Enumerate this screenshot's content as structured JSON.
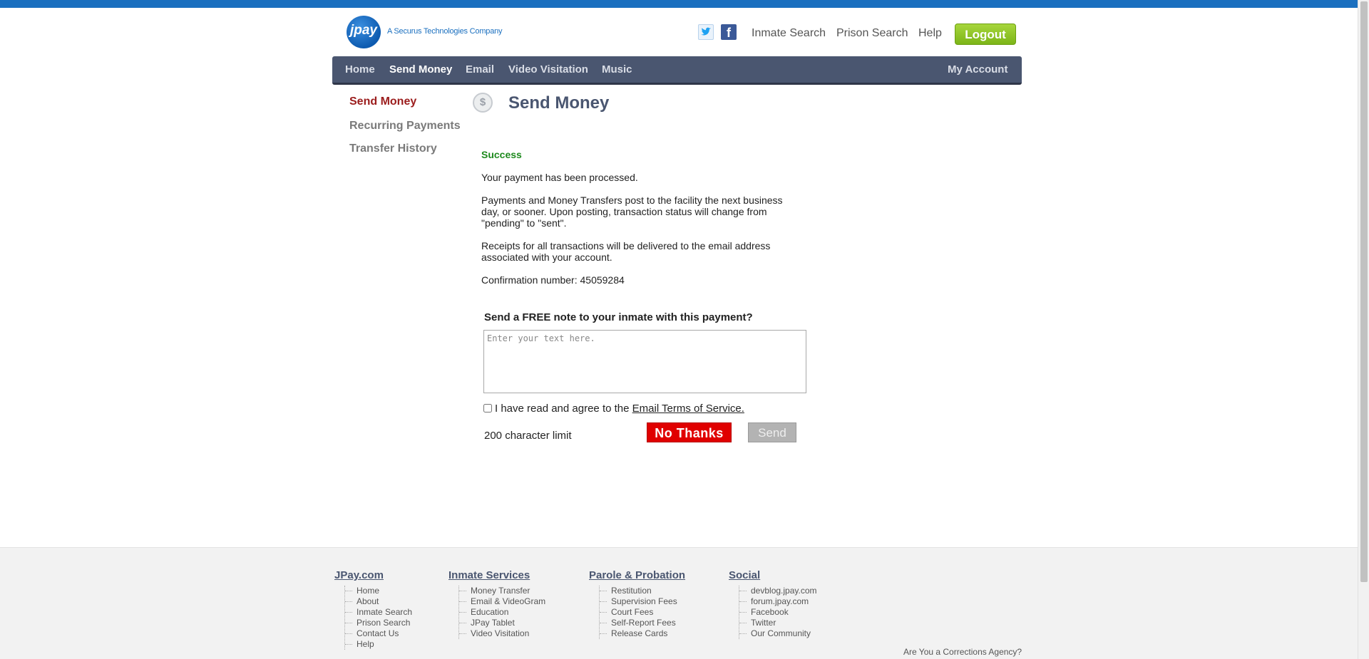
{
  "header": {
    "logo_text": "jpay",
    "tagline": "A Securus Technologies Company",
    "links": [
      "Inmate Search",
      "Prison Search",
      "Help"
    ],
    "logout_label": "Logout"
  },
  "nav": {
    "items": [
      "Home",
      "Send Money",
      "Email",
      "Video Visitation",
      "Music"
    ],
    "active": "Send Money",
    "account_label": "My Account"
  },
  "sidebar": {
    "items": [
      {
        "label": "Send Money",
        "active": true
      },
      {
        "label": "Recurring Payments",
        "active": false
      },
      {
        "label": "Transfer History",
        "active": false
      }
    ]
  },
  "main": {
    "page_icon": "money-icon",
    "title": "Send Money",
    "status": "Success",
    "messages": [
      "Your payment has been processed.",
      "Payments and Money Transfers post to the facility the next business day, or sooner. Upon posting, transaction status will change from \"pending\" to \"sent\".",
      "Receipts for all transactions will be delivered to the email address associated with your account.",
      "Confirmation number: 45059284"
    ],
    "note_prompt": "Send a FREE note to your inmate with this payment?",
    "note_placeholder": "Enter your text here.",
    "note_value": "",
    "agree_text": "I have read and agree to the",
    "agree_link": "Email Terms of Service.",
    "agree_checked": false,
    "char_limit": "200 character limit",
    "no_thanks_label": "No Thanks",
    "send_label": "Send"
  },
  "footer": {
    "columns": [
      {
        "title": "JPay.com",
        "links": [
          "Home",
          "About",
          "Inmate Search",
          "Prison Search",
          "Contact Us",
          "Help"
        ]
      },
      {
        "title": "Inmate Services",
        "links": [
          "Money Transfer",
          "Email & VideoGram",
          "Education",
          "JPay Tablet",
          "Video Visitation"
        ]
      },
      {
        "title": "Parole & Probation",
        "links": [
          "Restitution",
          "Supervision Fees",
          "Court Fees",
          "Self-Report Fees",
          "Release Cards"
        ]
      },
      {
        "title": "Social",
        "links": [
          "devblog.jpay.com",
          "forum.jpay.com",
          "Facebook",
          "Twitter",
          "Our Community"
        ]
      }
    ],
    "corrections_link": "Are You a Corrections Agency?"
  },
  "colors": {
    "brand_blue": "#1a6fbf",
    "nav_bg": "#4a5670",
    "success_green": "#1e8a1e",
    "active_red": "#9b1c1c",
    "no_thanks_red": "#e00000",
    "logout_green": "#7cb518"
  }
}
